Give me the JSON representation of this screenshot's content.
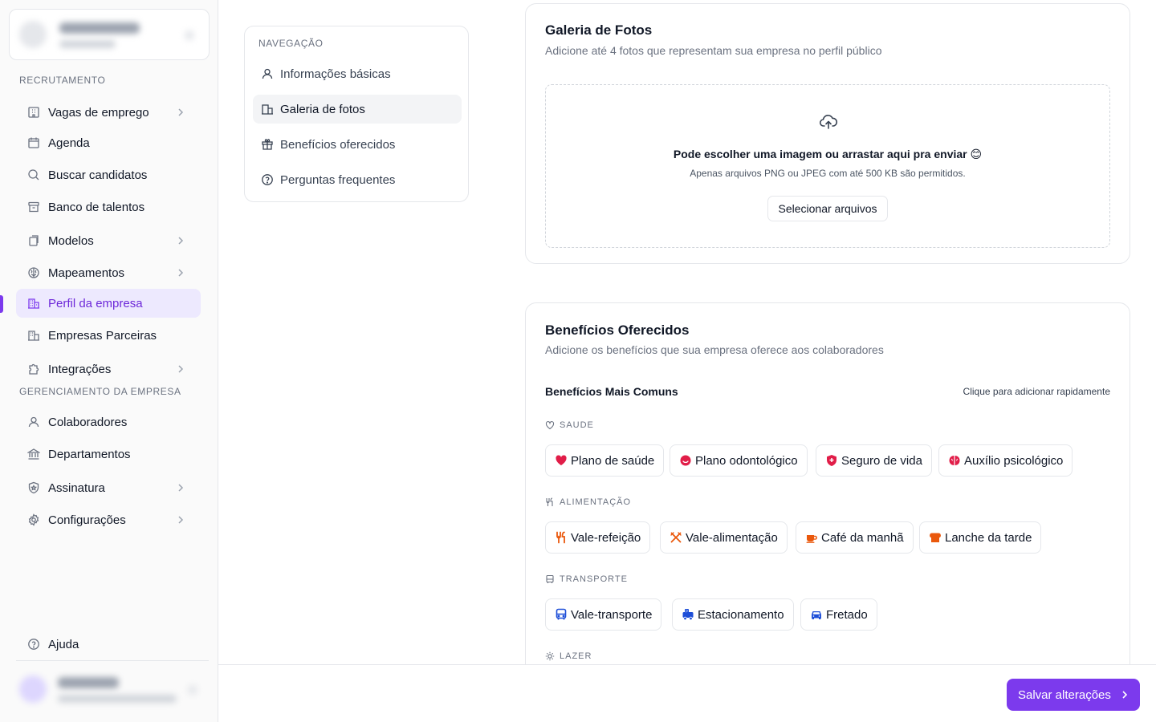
{
  "sidebar": {
    "sections": {
      "recruitment": "RECRUTAMENTO",
      "management": "GERENCIAMENTO DA EMPRESA"
    },
    "items": [
      {
        "label": "Vagas de emprego",
        "icon": "building-icon",
        "chevron": true
      },
      {
        "label": "Agenda",
        "icon": "calendar-icon",
        "chevron": false
      },
      {
        "label": "Buscar candidatos",
        "icon": "search-icon",
        "chevron": false
      },
      {
        "label": "Banco de talentos",
        "icon": "archive-icon",
        "chevron": false
      },
      {
        "label": "Modelos",
        "icon": "copy-icon",
        "chevron": true
      },
      {
        "label": "Mapeamentos",
        "icon": "brain-icon",
        "chevron": true
      },
      {
        "label": "Perfil da empresa",
        "icon": "building-icon",
        "chevron": false,
        "active": true
      },
      {
        "label": "Empresas Parceiras",
        "icon": "building-icon",
        "chevron": false
      },
      {
        "label": "Integrações",
        "icon": "puzzle-icon",
        "chevron": true
      },
      {
        "label": "Colaboradores",
        "icon": "user-icon",
        "chevron": false
      },
      {
        "label": "Departamentos",
        "icon": "bank-icon",
        "chevron": false
      },
      {
        "label": "Assinatura",
        "icon": "shield-icon",
        "chevron": true
      },
      {
        "label": "Configurações",
        "icon": "gear-icon",
        "chevron": true
      }
    ],
    "help": "Ajuda"
  },
  "page_nav": {
    "heading": "NAVEGAÇÃO",
    "items": [
      {
        "label": "Informações básicas",
        "icon": "user-icon"
      },
      {
        "label": "Galeria de fotos",
        "icon": "building-icon",
        "active": true
      },
      {
        "label": "Benefícios oferecidos",
        "icon": "gift-icon"
      },
      {
        "label": "Perguntas frequentes",
        "icon": "help-circle-icon"
      }
    ]
  },
  "gallery": {
    "title": "Galeria de Fotos",
    "subtitle": "Adicione até 4 fotos que representam sua empresa no perfil público",
    "drop_title": "Pode escolher uma imagem ou arrastar aqui pra enviar 😊",
    "drop_sub": "Apenas arquivos PNG ou JPEG com até 500 KB são permitidos.",
    "select_button": "Selecionar arquivos"
  },
  "benefits": {
    "title": "Benefícios Oferecidos",
    "subtitle": "Adicione os benefícios que sua empresa oferece aos colaboradores",
    "common_title": "Benefícios Mais Comuns",
    "common_hint": "Clique para adicionar rapidamente",
    "categories": [
      {
        "label": "SAUDE",
        "icon": "heart-outline-icon",
        "chips": [
          {
            "label": "Plano de saúde",
            "icon": "heart-icon",
            "color": "#e11d48"
          },
          {
            "label": "Plano odontológico",
            "icon": "smile-icon",
            "color": "#e11d48"
          },
          {
            "label": "Seguro de vida",
            "icon": "shield-plus-icon",
            "color": "#e11d48"
          },
          {
            "label": "Auxílio psicológico",
            "icon": "brain-icon",
            "color": "#e11d48"
          }
        ]
      },
      {
        "label": "ALIMENTAÇÃO",
        "icon": "utensils-icon",
        "chips": [
          {
            "label": "Vale-refeição",
            "icon": "utensils-icon",
            "color": "#ea580c"
          },
          {
            "label": "Vale-alimentação",
            "icon": "cutlery-cross-icon",
            "color": "#ea580c"
          },
          {
            "label": "Café da manhã",
            "icon": "coffee-icon",
            "color": "#ea580c"
          },
          {
            "label": "Lanche da tarde",
            "icon": "bread-icon",
            "color": "#ea580c"
          }
        ]
      },
      {
        "label": "TRANSPORTE",
        "icon": "bus-icon",
        "chips": [
          {
            "label": "Vale-transporte",
            "icon": "bus-icon",
            "color": "#1d4ed8"
          },
          {
            "label": "Estacionamento",
            "icon": "parking-icon",
            "color": "#1d4ed8"
          },
          {
            "label": "Fretado",
            "icon": "car-icon",
            "color": "#1d4ed8"
          }
        ]
      },
      {
        "label": "LAZER",
        "icon": "sun-icon",
        "chips": []
      }
    ]
  },
  "footer": {
    "save_button": "Salvar alterações"
  },
  "colors": {
    "accent": "#7c3aed",
    "active_bg": "#ede9fe",
    "health": "#e11d48",
    "food": "#ea580c",
    "transport": "#1d4ed8"
  }
}
